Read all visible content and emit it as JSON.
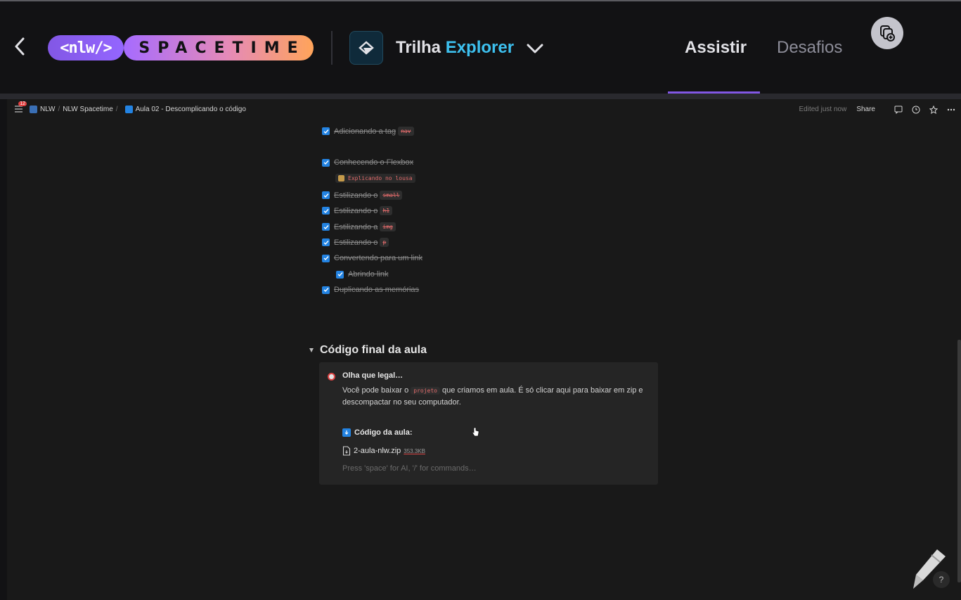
{
  "header": {
    "logo_tag": "<nlw/>",
    "logo_word": "SPACETIME",
    "trail_prefix": "Trilha",
    "trail_name": "Explorer",
    "tabs": [
      {
        "label": "Assistir",
        "active": true
      },
      {
        "label": "Desafios",
        "active": false
      }
    ],
    "accent_color": "#8257e5",
    "trail_color": "#3dc1f0"
  },
  "notion": {
    "breadcrumb": [
      "NLW",
      "NLW Spacetime",
      "Aula 02 - Descomplicando o código"
    ],
    "notification_count": "12",
    "edited": "Edited just now",
    "share": "Share",
    "todos": [
      {
        "text": "Adicionando a tag",
        "code": "nav",
        "indent": false
      },
      {
        "text": "Conhecendo o Flexbox",
        "code": "",
        "indent": false
      },
      {
        "text": "Estilizando o",
        "code": "small",
        "indent": false
      },
      {
        "text": "Estilizando o",
        "code": "h1",
        "indent": false
      },
      {
        "text": "Estilizando a",
        "code": "img",
        "indent": false
      },
      {
        "text": "Estilizando o",
        "code": "p",
        "indent": false
      },
      {
        "text": "Convertendo para um link",
        "code": "",
        "indent": false
      },
      {
        "text": "Abrindo link",
        "code": "",
        "indent": true
      },
      {
        "text": "Duplicando as memórias",
        "code": "",
        "indent": false
      }
    ],
    "note": "Explicando no lousa",
    "section_title": "Código final da aula",
    "callout": {
      "title": "Olha que legal…",
      "body_before": "Você pode baixar o",
      "body_code": "projeto",
      "body_after": "que criamos em aula. É só clicar aqui para baixar em zip e descompactar no seu computador.",
      "download_label": "Código da aula:",
      "file_name": "2-aula-nlw.zip",
      "file_size": "353.3KB",
      "placeholder": "Press 'space' for AI, '/' for commands…"
    },
    "help": "?"
  }
}
